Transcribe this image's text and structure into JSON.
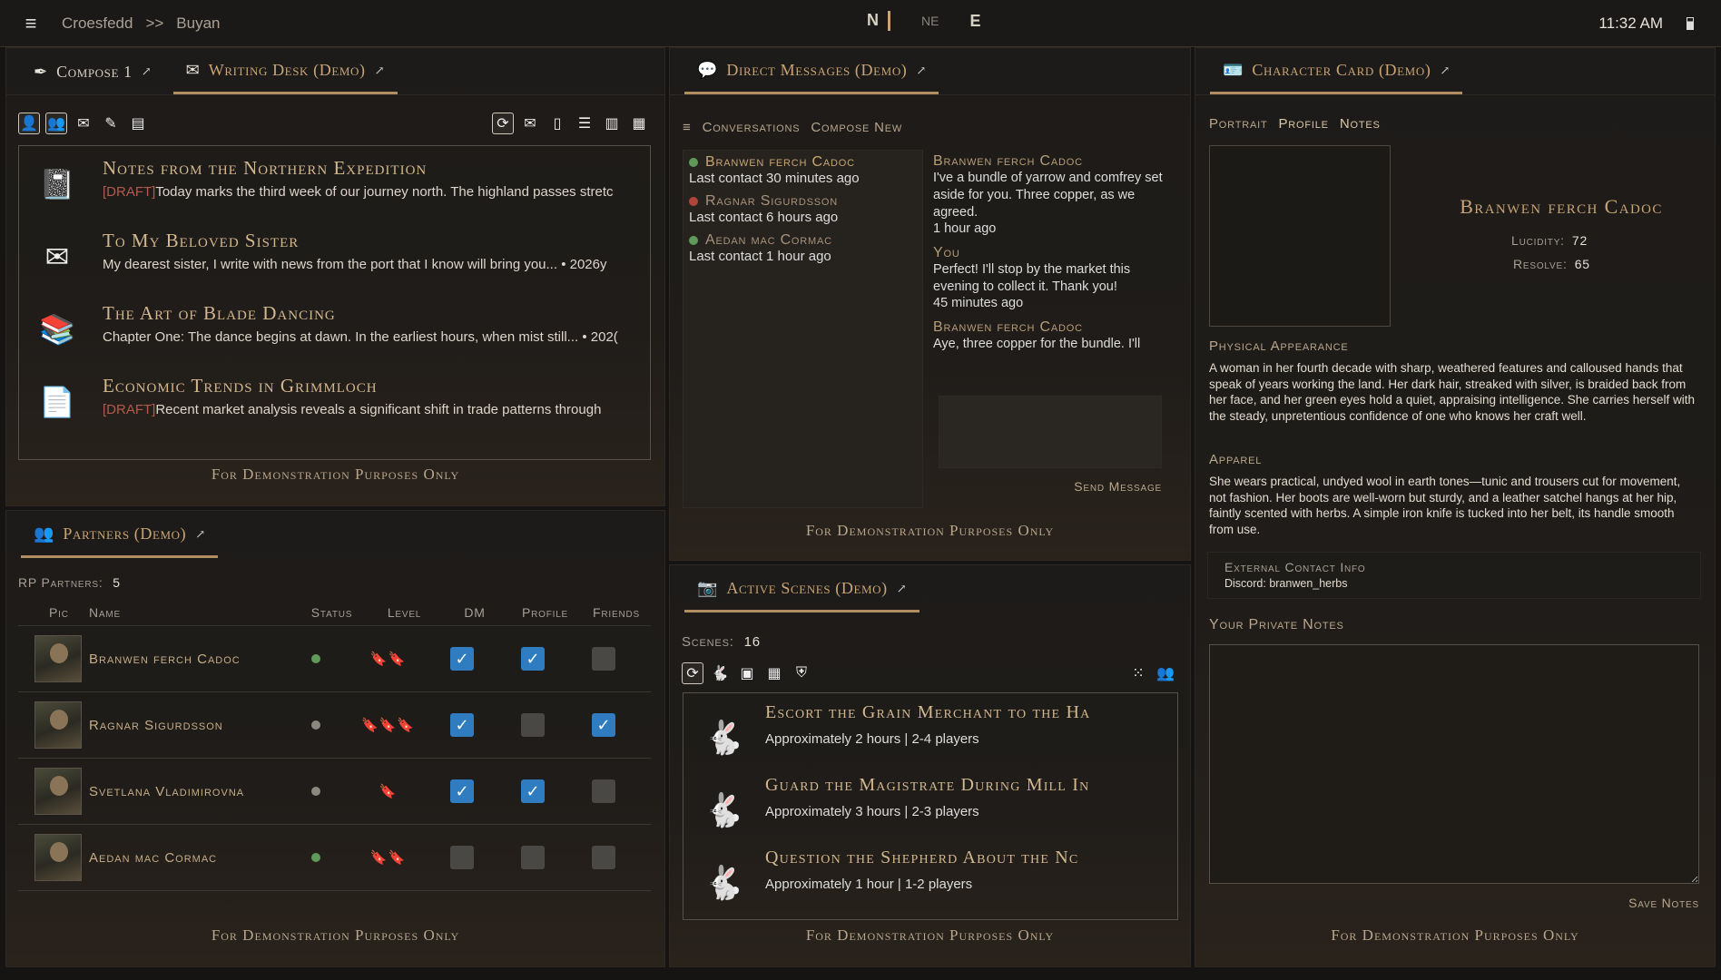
{
  "topbar": {
    "breadcrumb": [
      "Croesfedd",
      ">>",
      "Buyan"
    ],
    "compass": [
      "N",
      "NE",
      "E"
    ],
    "time": "11:32 AM"
  },
  "writing": {
    "tabs": [
      {
        "label": "Compose 1",
        "icon": "quill-icon"
      },
      {
        "label": "Writing Desk (Demo)",
        "icon": "envelope-icon"
      }
    ],
    "documents": [
      {
        "title": "Notes from the Northern Expedition",
        "draft": "[DRAFT]",
        "text": "Today marks the third week of our journey north. The highland passes stretc",
        "icon": "notebook-icon"
      },
      {
        "title": "To My Beloved Sister",
        "draft": "",
        "text": "My dearest sister, I write with news from the port that I know will bring you... • 2026y",
        "icon": "letter-icon"
      },
      {
        "title": "The Art of Blade Dancing",
        "draft": "",
        "text": "Chapter One: The dance begins at dawn. In the earliest hours, when mist still... • 202(",
        "icon": "books-icon"
      },
      {
        "title": "Economic Trends in Grimmloch",
        "draft": "[DRAFT]",
        "text": "Recent market analysis reveals a significant shift in trade patterns through",
        "icon": "document-icon"
      }
    ],
    "footer": "For Demonstration Purposes Only"
  },
  "partners": {
    "tab": "Partners (Demo)",
    "count_label": "RP Partners:",
    "count": "5",
    "columns": [
      "Pic",
      "Name",
      "Status",
      "Level",
      "DM",
      "Profile",
      "Friends"
    ],
    "rows": [
      {
        "name": "Branwen ferch Cadoc",
        "status": "online",
        "level": "2",
        "dm": true,
        "profile": true,
        "friends": false
      },
      {
        "name": "Ragnar Sigurdsson",
        "status": "away",
        "level": "3",
        "dm": true,
        "profile": false,
        "friends": true
      },
      {
        "name": "Svetlana Vladimirovna",
        "status": "away",
        "level": "1",
        "dm": true,
        "profile": true,
        "friends": false
      },
      {
        "name": "Aedan mac Cormac",
        "status": "online",
        "level": "2",
        "dm": false,
        "profile": false,
        "friends": false
      }
    ],
    "footer": "For Demonstration Purposes Only"
  },
  "dm": {
    "tab": "Direct Messages (Demo)",
    "subtabs": [
      "Conversations",
      "Compose New"
    ],
    "conversations": [
      {
        "name": "Branwen ferch Cadoc",
        "sub": "Last contact 30 minutes ago",
        "status_color": "#5f9a5a",
        "name_color": "#c9a474"
      },
      {
        "name": "Ragnar Sigurdsson",
        "sub": "Last contact 6 hours ago",
        "status_color": "#b0453b",
        "name_color": "#a8927a"
      },
      {
        "name": "Aedan mac Cormac",
        "sub": "Last contact 1 hour ago",
        "status_color": "#5f9a5a",
        "name_color": "#a8927a"
      }
    ],
    "messages": [
      {
        "from": "Branwen ferch Cadoc",
        "body": "I've a bundle of yarrow and comfrey set aside for you. Three copper, as we agreed.",
        "time": "1 hour ago"
      },
      {
        "from": "You",
        "body": "Perfect! I'll stop by the market this evening to collect it. Thank you!",
        "time": "45 minutes ago"
      },
      {
        "from": "Branwen ferch Cadoc",
        "body": "Aye, three copper for the bundle. I'll",
        "time": ""
      }
    ],
    "send_label": "Send Message",
    "footer": "For Demonstration Purposes Only"
  },
  "scenes": {
    "tab": "Active Scenes (Demo)",
    "count_label": "Scenes:",
    "count": "16",
    "items": [
      {
        "title": "Escort the Grain Merchant to the Ha",
        "sub": "Approximately 2 hours | 2-4 players"
      },
      {
        "title": "Guard the Magistrate During Mill In",
        "sub": "Approximately 3 hours | 2-3 players"
      },
      {
        "title": "Question the Shepherd About the Nc",
        "sub": "Approximately 1 hour | 1-2 players"
      }
    ],
    "footer": "For Demonstration Purposes Only"
  },
  "card": {
    "tab": "Character Card (Demo)",
    "subtabs": [
      "Portrait",
      "Profile",
      "Notes"
    ],
    "name": "Branwen ferch Cadoc",
    "lucidity_label": "Lucidity:",
    "lucidity": "72",
    "resolve_label": "Resolve:",
    "resolve": "65",
    "appearance_label": "Physical Appearance",
    "appearance": "A woman in her fourth decade with sharp, weathered features and calloused hands that speak of years working the land. Her dark hair, streaked with silver, is braided back from her face, and her green eyes hold a quiet, appraising intelligence. She carries herself with the steady, unpretentious confidence of one who knows her craft well.",
    "apparel_label": "Apparel",
    "apparel": "She wears practical, undyed wool in earth tones—tunic and trousers cut for movement, not fashion. Her boots are well-worn but sturdy, and a leather satchel hangs at her hip, faintly scented with herbs. A simple iron knife is tucked into her belt, its handle smooth from use.",
    "contact_label": "External Contact Info",
    "contact": "Discord: branwen_herbs",
    "notes_label": "Your Private Notes",
    "save_label": "Save Notes",
    "footer": "For Demonstration Purposes Only"
  }
}
